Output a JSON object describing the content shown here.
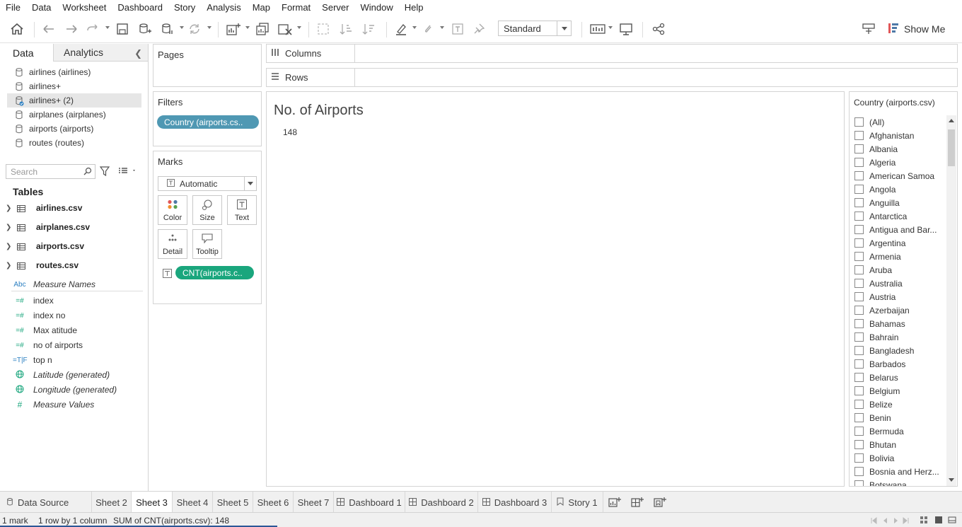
{
  "menu": [
    "File",
    "Data",
    "Worksheet",
    "Dashboard",
    "Story",
    "Analysis",
    "Map",
    "Format",
    "Server",
    "Window",
    "Help"
  ],
  "toolbar": {
    "fit_select": "Standard",
    "show_me": "Show Me"
  },
  "data_pane": {
    "tab_data": "Data",
    "tab_analytics": "Analytics",
    "datasources": [
      {
        "label": "airlines (airlines)"
      },
      {
        "label": "airlines+"
      },
      {
        "label": "airlines+ (2)"
      },
      {
        "label": "airplanes (airplanes)"
      },
      {
        "label": "airports (airports)"
      },
      {
        "label": "routes (routes)"
      }
    ],
    "search_placeholder": "Search",
    "tables_header": "Tables",
    "tables": [
      "airlines.csv",
      "airplanes.csv",
      "airports.csv",
      "routes.csv"
    ],
    "fields": [
      {
        "icon": "Abc",
        "label": "Measure Names",
        "italic": true
      },
      {
        "icon": "=#",
        "label": "index",
        "italic": false
      },
      {
        "icon": "=#",
        "label": "index no",
        "italic": false
      },
      {
        "icon": "=#",
        "label": "Max atitude",
        "italic": false
      },
      {
        "icon": "=#",
        "label": "no of airports",
        "italic": false
      },
      {
        "icon": "=T|F",
        "label": "top n",
        "italic": false
      },
      {
        "icon": "globe-icon",
        "label": "Latitude (generated)",
        "italic": true
      },
      {
        "icon": "globe-icon",
        "label": "Longitude (generated)",
        "italic": true
      },
      {
        "icon": "#",
        "label": "Measure Values",
        "italic": true
      }
    ]
  },
  "pages": {
    "title": "Pages"
  },
  "filters": {
    "title": "Filters",
    "pill": "Country (airports.cs.."
  },
  "marks": {
    "title": "Marks",
    "type": "Automatic",
    "buttons": {
      "color": "Color",
      "size": "Size",
      "text": "Text",
      "detail": "Detail",
      "tooltip": "Tooltip"
    },
    "pill": "CNT(airports.c.."
  },
  "shelves": {
    "columns": "Columns",
    "rows": "Rows"
  },
  "view": {
    "title": "No. of Airports",
    "value": "148"
  },
  "filter_card": {
    "title": "Country (airports.csv)",
    "items": [
      "(All)",
      "Afghanistan",
      "Albania",
      "Algeria",
      "American Samoa",
      "Angola",
      "Anguilla",
      "Antarctica",
      "Antigua and Bar...",
      "Argentina",
      "Armenia",
      "Aruba",
      "Australia",
      "Austria",
      "Azerbaijan",
      "Bahamas",
      "Bahrain",
      "Bangladesh",
      "Barbados",
      "Belarus",
      "Belgium",
      "Belize",
      "Benin",
      "Bermuda",
      "Bhutan",
      "Bolivia",
      "Bosnia and Herz...",
      "Botswana"
    ]
  },
  "sheet_tabs": [
    "Data Source",
    "Sheet 2",
    "Sheet 3",
    "Sheet 4",
    "Sheet 5",
    "Sheet 6",
    "Sheet 7",
    "Dashboard 1",
    "Dashboard 2",
    "Dashboard 3",
    "Story 1"
  ],
  "status": {
    "marks": "1 mark",
    "rows": "1 row by 1 column",
    "sum": "SUM of CNT(airports.csv): 148"
  },
  "colors": {
    "filter_pill": "#4f98b3",
    "measure_pill": "#1aa67d",
    "accent": "#1f77b4"
  }
}
